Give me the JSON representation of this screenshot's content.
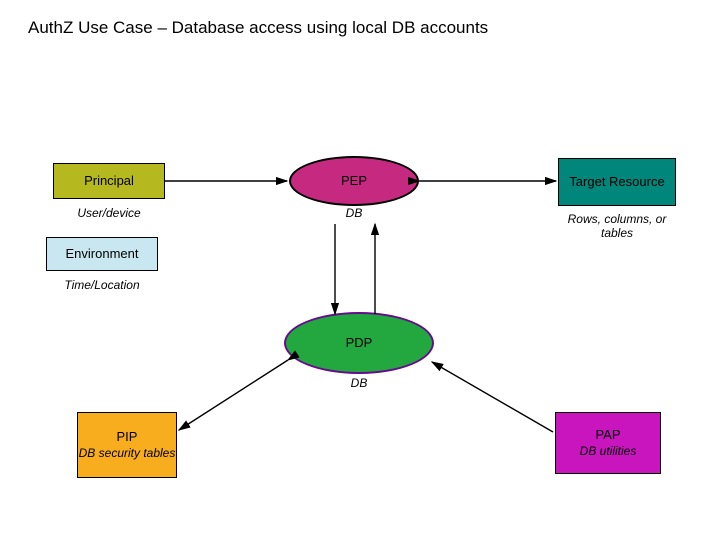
{
  "title": "AuthZ Use Case – Database access using local DB accounts",
  "principal": {
    "label": "Principal",
    "sub": "User/device"
  },
  "environment": {
    "label": "Environment",
    "sub": "Time/Location"
  },
  "pep": {
    "label": "PEP",
    "sub": "DB"
  },
  "target": {
    "label": "Target Resource",
    "sub": "Rows, columns, or tables"
  },
  "pdp": {
    "label": "PDP",
    "sub": "DB"
  },
  "pip": {
    "label": "PIP",
    "sub": "DB security tables"
  },
  "pap": {
    "label": "PAP",
    "sub": "DB utilities"
  }
}
